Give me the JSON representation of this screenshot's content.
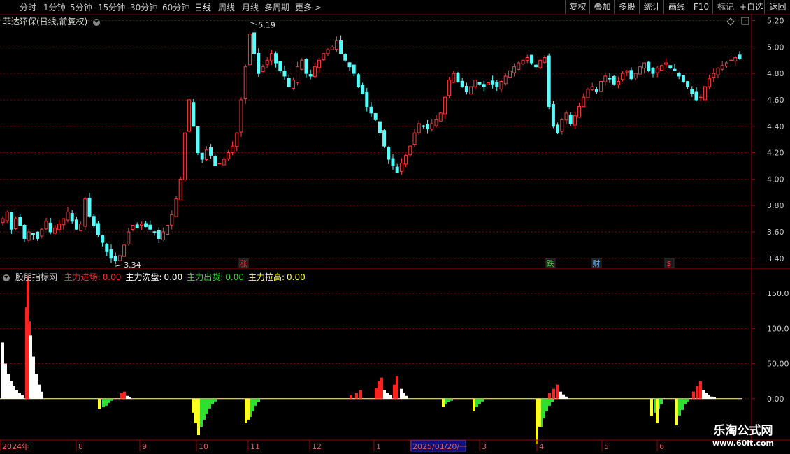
{
  "toolbar": {
    "periods": [
      "分时",
      "1分钟",
      "5分钟",
      "15分钟",
      "30分钟",
      "60分钟",
      "日线",
      "周线",
      "月线",
      "多周期",
      "更多 >"
    ],
    "active_period": "日线",
    "right_buttons": [
      "复权",
      "叠加",
      "多股",
      "统计",
      "画线",
      "F10",
      "标记",
      "+自选",
      "返回"
    ]
  },
  "price_panel": {
    "title": "菲达环保(日线,前复权)",
    "high_label": "5.19",
    "low_label": "3.34",
    "markers": [
      {
        "text": "涨",
        "color": "#ff3030"
      },
      {
        "text": "跌",
        "color": "#40d040"
      },
      {
        "text": "财",
        "color": "#6ab8ff"
      },
      {
        "text": "$",
        "color": "#ff3030"
      }
    ]
  },
  "indicator_panel": {
    "name": "股朋指标网",
    "fields": [
      {
        "label": "主力进场:",
        "value": "0.00",
        "color": "#ff3030"
      },
      {
        "label": "主力洗盘:",
        "value": "0.00",
        "color": "#ffffff"
      },
      {
        "label": "主力出货:",
        "value": "0.00",
        "color": "#30e030"
      },
      {
        "label": "主力拉高:",
        "value": "0.00",
        "color": "#ffff40"
      }
    ]
  },
  "time_axis": {
    "labels": [
      "2024年",
      "8",
      "9",
      "10",
      "11",
      "12",
      "1",
      "2025/01/20/一",
      "3",
      "4",
      "5",
      "6"
    ],
    "highlight": "2025/01/20/一"
  },
  "watermark": {
    "line1": "乐淘公式网",
    "line2": "www.60lt.com"
  },
  "colors": {
    "up": "#ff3a3a",
    "down": "#54ffff",
    "grid": "#7a0000",
    "axis_text": "#d0d0d0"
  },
  "chart_data": [
    {
      "type": "candlestick",
      "title": "菲达环保(日线,前复权)",
      "yticks": [
        "5.20",
        "5.00",
        "4.80",
        "4.60",
        "4.40",
        "4.20",
        "4.00",
        "3.80",
        "3.60",
        "3.40"
      ],
      "ylim": [
        3.33,
        5.24
      ],
      "x_range": [
        "2024-07",
        "2025-06"
      ],
      "max_point": {
        "value": 5.19,
        "label": "5.19"
      },
      "min_point": {
        "value": 3.34,
        "label": "3.34"
      },
      "closes": [
        3.7,
        3.75,
        3.62,
        3.7,
        3.65,
        3.55,
        3.6,
        3.58,
        3.55,
        3.62,
        3.68,
        3.6,
        3.63,
        3.66,
        3.7,
        3.75,
        3.68,
        3.62,
        3.66,
        3.85,
        3.72,
        3.65,
        3.58,
        3.52,
        3.45,
        3.4,
        3.38,
        3.42,
        3.5,
        3.6,
        3.65,
        3.63,
        3.66,
        3.64,
        3.62,
        3.6,
        3.55,
        3.6,
        3.65,
        3.73,
        3.85,
        4.0,
        4.35,
        4.6,
        4.4,
        4.2,
        4.15,
        4.22,
        4.18,
        4.1,
        4.12,
        4.15,
        4.2,
        4.25,
        4.35,
        4.6,
        4.85,
        5.1,
        4.95,
        4.8,
        4.85,
        4.9,
        4.95,
        4.88,
        4.82,
        4.78,
        4.7,
        4.75,
        4.85,
        4.9,
        4.8,
        4.78,
        4.85,
        4.9,
        4.95,
        4.98,
        5.0,
        5.05,
        4.95,
        4.9,
        4.85,
        4.8,
        4.7,
        4.65,
        4.55,
        4.5,
        4.45,
        4.35,
        4.25,
        4.15,
        4.1,
        4.05,
        4.12,
        4.18,
        4.25,
        4.35,
        4.42,
        4.4,
        4.38,
        4.42,
        4.45,
        4.5,
        4.62,
        4.75,
        4.8,
        4.74,
        4.7,
        4.66,
        4.7,
        4.75,
        4.72,
        4.7,
        4.73,
        4.72,
        4.7,
        4.74,
        4.78,
        4.82,
        4.85,
        4.88,
        4.9,
        4.92,
        4.88,
        4.85,
        4.9,
        4.92,
        4.55,
        4.4,
        4.35,
        4.45,
        4.5,
        4.42,
        4.48,
        4.55,
        4.62,
        4.68,
        4.7,
        4.66,
        4.74,
        4.78,
        4.76,
        4.72,
        4.74,
        4.8,
        4.82,
        4.76,
        4.8,
        4.85,
        4.88,
        4.82,
        4.8,
        4.84,
        4.86,
        4.88,
        4.84,
        4.82,
        4.78,
        4.74,
        4.7,
        4.65,
        4.6,
        4.62,
        4.7,
        4.76,
        4.8,
        4.84,
        4.86,
        4.88,
        4.9,
        4.92,
        4.91
      ]
    },
    {
      "type": "bar",
      "title": "股朋指标网",
      "yticks": [
        "150.0",
        "100.0",
        "50.00",
        "0.00"
      ],
      "ylim": [
        -55,
        180
      ],
      "series": [
        {
          "name": "主力进场",
          "color": "#ff2020",
          "points": [
            [
              36,
              130
            ],
            [
              38,
              175
            ],
            [
              40,
              110
            ],
            [
              172,
              8
            ],
            [
              176,
              10
            ],
            [
              500,
              5
            ],
            [
              508,
              8
            ],
            [
              514,
              12
            ],
            [
              536,
              15
            ],
            [
              540,
              25
            ],
            [
              544,
              30
            ],
            [
              562,
              20
            ],
            [
              566,
              32
            ],
            [
              784,
              8
            ],
            [
              790,
              14
            ],
            [
              796,
              20
            ],
            [
              990,
              10
            ],
            [
              995,
              18
            ],
            [
              1000,
              25
            ]
          ]
        },
        {
          "name": "主力洗盘",
          "color": "#ffffff",
          "points": [
            [
              2,
              80
            ],
            [
              6,
              50
            ],
            [
              10,
              35
            ],
            [
              14,
              25
            ],
            [
              18,
              18
            ],
            [
              22,
              12
            ],
            [
              26,
              8
            ],
            [
              30,
              5
            ],
            [
              42,
              90
            ],
            [
              46,
              60
            ],
            [
              50,
              35
            ],
            [
              54,
              20
            ],
            [
              58,
              10
            ],
            [
              180,
              4
            ],
            [
              184,
              2
            ],
            [
              548,
              12
            ],
            [
              552,
              8
            ],
            [
              556,
              5
            ],
            [
              572,
              14
            ],
            [
              576,
              8
            ],
            [
              580,
              4
            ],
            [
              800,
              10
            ],
            [
              804,
              6
            ],
            [
              808,
              3
            ],
            [
              1004,
              12
            ],
            [
              1008,
              8
            ],
            [
              1012,
              5
            ],
            [
              1016,
              3
            ],
            [
              1020,
              2
            ]
          ]
        },
        {
          "name": "主力出货",
          "color": "#30e030",
          "points": [
            [
              146,
              -12
            ],
            [
              150,
              -10
            ],
            [
              154,
              -6
            ],
            [
              158,
              -3
            ],
            [
              286,
              -40
            ],
            [
              290,
              -30
            ],
            [
              294,
              -22
            ],
            [
              298,
              -14
            ],
            [
              302,
              -8
            ],
            [
              306,
              -4
            ],
            [
              356,
              -26
            ],
            [
              360,
              -18
            ],
            [
              364,
              -10
            ],
            [
              368,
              -5
            ],
            [
              636,
              -8
            ],
            [
              640,
              -5
            ],
            [
              644,
              -3
            ],
            [
              680,
              -12
            ],
            [
              684,
              -8
            ],
            [
              688,
              -4
            ],
            [
              772,
              -40
            ],
            [
              776,
              -28
            ],
            [
              780,
              -18
            ],
            [
              784,
              -10
            ],
            [
              788,
              -5
            ],
            [
              936,
              -20
            ],
            [
              940,
              -14
            ],
            [
              944,
              -8
            ],
            [
              970,
              -24
            ],
            [
              974,
              -16
            ],
            [
              978,
              -8
            ],
            [
              982,
              -4
            ]
          ]
        },
        {
          "name": "主力拉高",
          "color": "#ffff20",
          "points": [
            [
              140,
              -15
            ],
            [
              274,
              -20
            ],
            [
              278,
              -35
            ],
            [
              282,
              -52
            ],
            [
              350,
              -35
            ],
            [
              354,
              -30
            ],
            [
              632,
              -12
            ],
            [
              676,
              -18
            ],
            [
              766,
              -65
            ],
            [
              770,
              -40
            ],
            [
              930,
              -25
            ],
            [
              938,
              -35
            ],
            [
              966,
              -38
            ]
          ]
        }
      ]
    }
  ]
}
